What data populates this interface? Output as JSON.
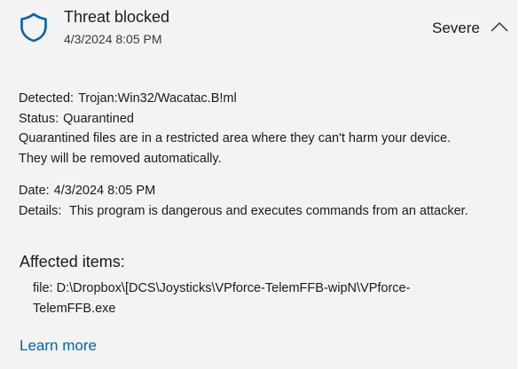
{
  "threat": {
    "title": "Threat blocked",
    "timestamp": "4/3/2024 8:05 PM",
    "severity": "Severe",
    "icon": "shield-icon",
    "accent": "#0063b1"
  },
  "details": {
    "detected_label": "Detected:",
    "detected_value": "Trojan:Win32/Wacatac.B!ml",
    "status_label": "Status:",
    "status_value": "Quarantined",
    "status_note_line1": "Quarantined files are in a restricted area where they can't harm your device.",
    "status_note_line2": "They will be removed automatically.",
    "date_label": "Date:",
    "date_value": "4/3/2024 8:05 PM",
    "details_label": "Details:",
    "details_value": "This program is dangerous and executes commands from an attacker."
  },
  "affected": {
    "title": "Affected items:",
    "file": "file: D:\\Dropbox\\[DCS\\Joysticks\\VPforce-TelemFFB-wipN\\VPforce-TelemFFB.exe"
  },
  "learn_more": "Learn more"
}
